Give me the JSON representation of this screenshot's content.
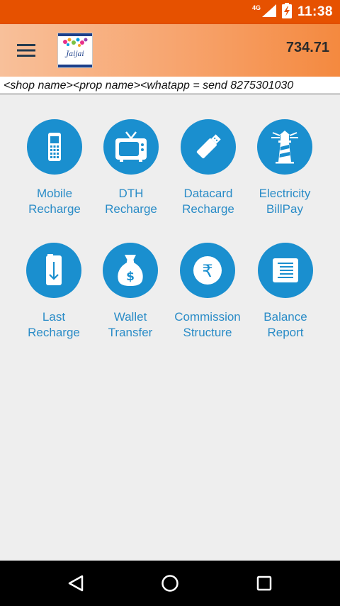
{
  "status_bar": {
    "network": "4G",
    "time": "11:38"
  },
  "app_bar": {
    "logo_text": "Jaijai",
    "balance": "734.71"
  },
  "marquee": {
    "text": "<shop name><prop name><whatapp  = send 8275301030"
  },
  "tiles": [
    {
      "line1": "Mobile",
      "line2": "Recharge",
      "icon": "mobile-phone-icon"
    },
    {
      "line1": "DTH",
      "line2": "Recharge",
      "icon": "tv-icon"
    },
    {
      "line1": "Datacard",
      "line2": "Recharge",
      "icon": "usb-dongle-icon"
    },
    {
      "line1": "Electricity",
      "line2": "BillPay",
      "icon": "lighthouse-icon"
    },
    {
      "line1": "Last",
      "line2": "Recharge",
      "icon": "phone-down-arrow-icon"
    },
    {
      "line1": "Wallet",
      "line2": "Transfer",
      "icon": "money-bag-icon"
    },
    {
      "line1": "Commission",
      "line2": "Structure",
      "icon": "rupee-icon"
    },
    {
      "line1": "Balance",
      "line2": "Report",
      "icon": "document-icon"
    }
  ],
  "colors": {
    "status_bar": "#e65100",
    "icon_circle": "#1a8fcf",
    "label_text": "#2a8cc7",
    "background": "#eeeeee"
  }
}
